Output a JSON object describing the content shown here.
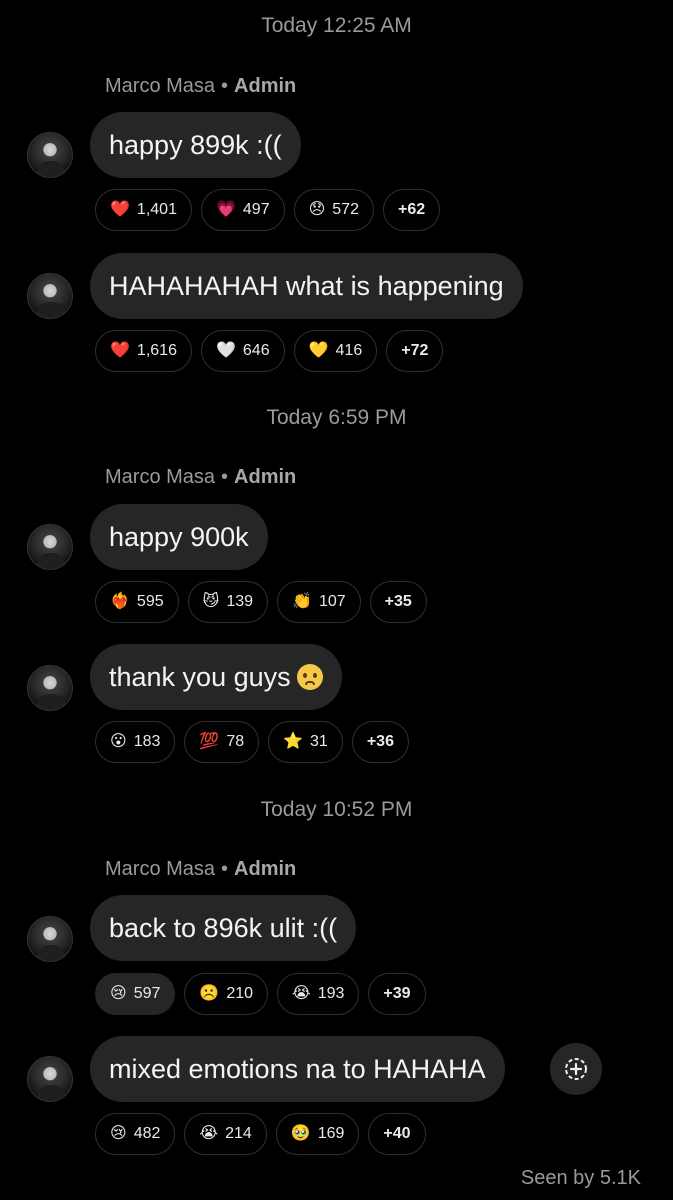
{
  "groups": [
    {
      "timestamp": "Today 12:25 AM",
      "sender": {
        "name": "Marco Masa",
        "role": "Admin"
      },
      "messages": [
        {
          "text": "happy 899k :((",
          "reactions": [
            {
              "icon": "❤️",
              "count": "1,401"
            },
            {
              "icon": "💗",
              "count": "497"
            },
            {
              "icon": "😞",
              "count": "572"
            },
            {
              "icon": "",
              "count": "+62"
            }
          ]
        },
        {
          "text": "HAHAHAHAH what is happening",
          "reactions": [
            {
              "icon": "❤️",
              "count": "1,616"
            },
            {
              "icon": "🤍",
              "count": "646"
            },
            {
              "icon": "💛",
              "count": "416"
            },
            {
              "icon": "",
              "count": "+72"
            }
          ]
        }
      ]
    },
    {
      "timestamp": "Today 6:59 PM",
      "sender": {
        "name": "Marco Masa",
        "role": "Admin"
      },
      "messages": [
        {
          "text": "happy 900k",
          "reactions": [
            {
              "icon": "❤️‍🔥",
              "count": "595"
            },
            {
              "icon": "😼",
              "count": "139"
            },
            {
              "icon": "👏",
              "count": "107"
            },
            {
              "icon": "",
              "count": "+35"
            }
          ]
        },
        {
          "text": "thank you guys",
          "emoji": "🥹",
          "reactions": [
            {
              "icon": "😮",
              "count": "183"
            },
            {
              "icon": "💯",
              "count": "78"
            },
            {
              "icon": "⭐",
              "count": "31"
            },
            {
              "icon": "",
              "count": "+36"
            }
          ]
        }
      ]
    },
    {
      "timestamp": "Today 10:52 PM",
      "sender": {
        "name": "Marco Masa",
        "role": "Admin"
      },
      "messages": [
        {
          "text": "back to 896k ulit :((",
          "reactions": [
            {
              "icon": "😢",
              "count": "597"
            },
            {
              "icon": "☹️",
              "count": "210"
            },
            {
              "icon": "😭",
              "count": "193"
            },
            {
              "icon": "",
              "count": "+39"
            }
          ]
        },
        {
          "text": "mixed emotions na to HAHAHA",
          "reactions": [
            {
              "icon": "😢",
              "count": "482"
            },
            {
              "icon": "😭",
              "count": "214"
            },
            {
              "icon": "🥹",
              "count": "169"
            },
            {
              "icon": "",
              "count": "+40"
            }
          ]
        }
      ]
    }
  ],
  "seen": "Seen by 5.1K"
}
